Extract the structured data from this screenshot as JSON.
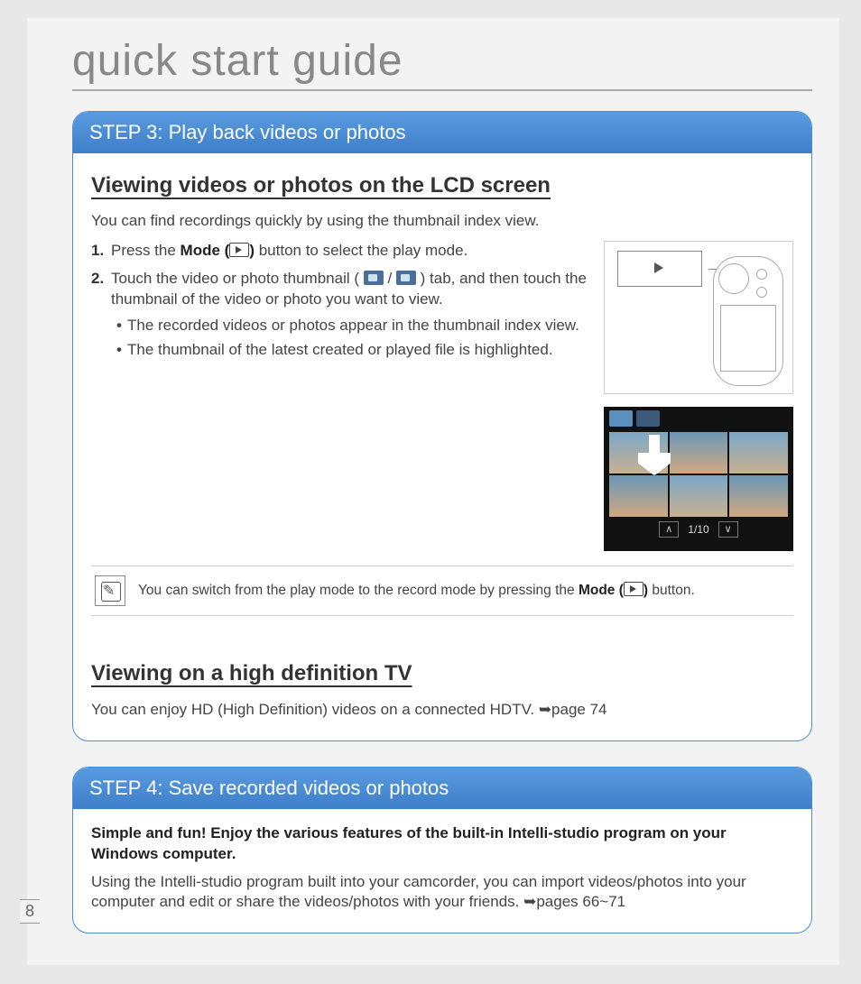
{
  "pageTitle": "quick start guide",
  "pageNumber": "8",
  "step3": {
    "header": "STEP 3: Play back videos or photos",
    "section1": {
      "heading": "Viewing videos or photos on the LCD screen",
      "intro": "You can find recordings quickly by using the thumbnail index view.",
      "items": [
        {
          "num": "1.",
          "pre": "Press the ",
          "bold": "Mode (",
          "post": ") ",
          "rest": "button to select the play mode."
        },
        {
          "num": "2.",
          "text": "Touch the video or photo thumbnail ( ",
          "mid": " / ",
          "after": " ) tab, and then touch the thumbnail of the video or photo you want to view.",
          "bullets": [
            "The recorded videos or photos appear in the thumbnail index view.",
            "The thumbnail of the latest created or played file is highlighted."
          ]
        }
      ],
      "pagination": "1/10",
      "note": {
        "pre": "You can switch from the play mode to the record mode by pressing the ",
        "bold": "Mode (",
        "post": ")",
        "end": " button."
      }
    },
    "section2": {
      "heading": "Viewing on a high definition TV",
      "text": "You can enjoy HD (High Definition) videos on a connected HDTV. ",
      "ref": "➥page 74"
    }
  },
  "step4": {
    "header": "STEP 4: Save recorded videos or photos",
    "bold": "Simple and fun! Enjoy the various features of the built-in Intelli-studio program on your Windows computer.",
    "text": "Using the Intelli-studio program built into your camcorder, you can import videos/photos into your computer and edit or share the videos/photos with your friends. ",
    "ref": "➥pages 66~71"
  }
}
